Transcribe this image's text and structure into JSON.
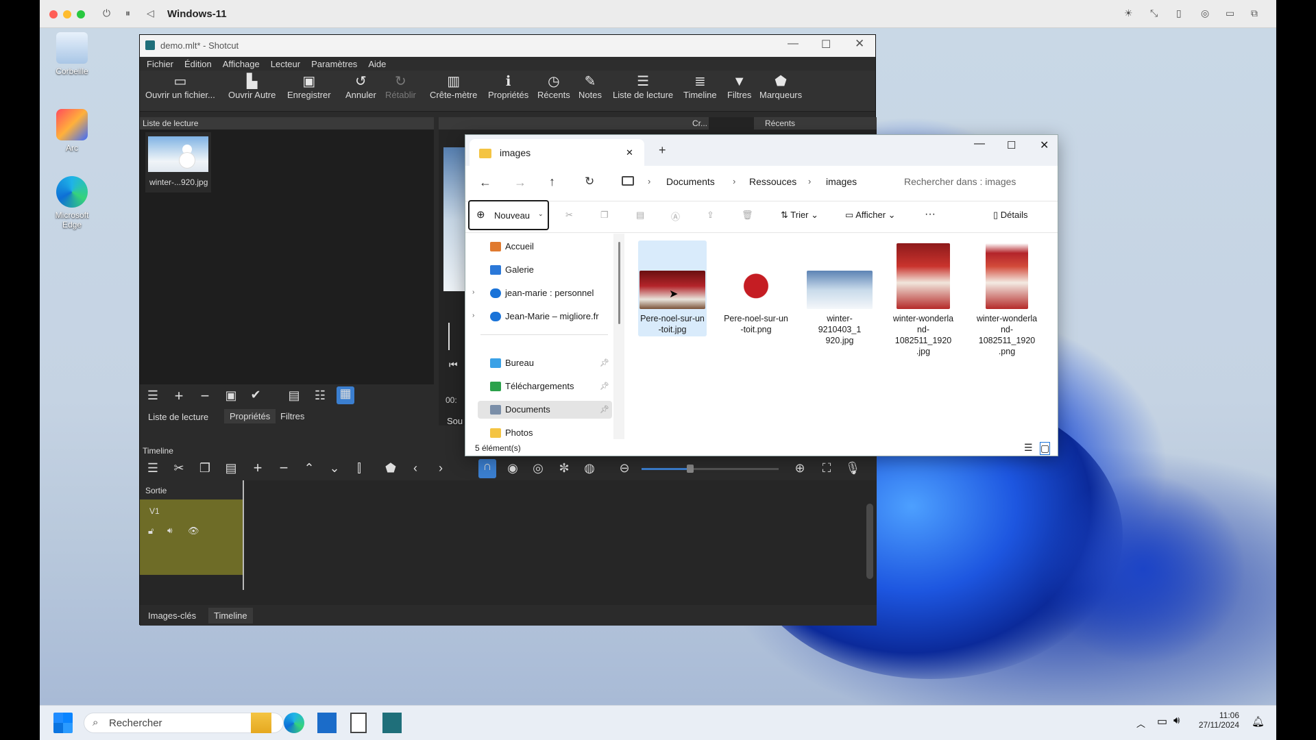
{
  "host": {
    "title": "Windows-11"
  },
  "desktop": {
    "icons": [
      {
        "label": "Corbeille"
      },
      {
        "label": "Arc"
      },
      {
        "label": "Microsoft Edge"
      }
    ]
  },
  "shotcut": {
    "title": "demo.mlt* - Shotcut",
    "menu": [
      "Fichier",
      "Édition",
      "Affichage",
      "Lecteur",
      "Paramètres",
      "Aide"
    ],
    "toolbar": [
      {
        "label": "Ouvrir un fichier...",
        "icon": "open-file-icon"
      },
      {
        "label": "Ouvrir Autre",
        "icon": "open-other-icon"
      },
      {
        "label": "Enregistrer",
        "icon": "save-icon"
      },
      {
        "label": "Annuler",
        "icon": "undo-icon"
      },
      {
        "label": "Rétablir",
        "icon": "redo-icon",
        "disabled": true
      },
      {
        "label": "Crête-mètre",
        "icon": "peak-meter-icon"
      },
      {
        "label": "Propriétés",
        "icon": "info-icon"
      },
      {
        "label": "Récents",
        "icon": "clock-icon"
      },
      {
        "label": "Notes",
        "icon": "notes-icon"
      },
      {
        "label": "Liste de lecture",
        "icon": "playlist-icon"
      },
      {
        "label": "Timeline",
        "icon": "timeline-icon"
      },
      {
        "label": "Filtres",
        "icon": "filter-icon"
      },
      {
        "label": "Marqueurs",
        "icon": "marker-icon"
      }
    ],
    "playlist": {
      "header": "Liste de lecture",
      "item": "winter-...920.jpg",
      "tabs": [
        "Liste de lecture",
        "Propriétés",
        "Filtres"
      ]
    },
    "side_headers": {
      "cr": "Cr...",
      "recents": "Récents"
    },
    "source_tab": "Sou",
    "timecode": "00:",
    "timeline": {
      "header": "Timeline",
      "output": "Sortie",
      "track": "V1",
      "tabs": [
        "Images-clés",
        "Timeline"
      ]
    }
  },
  "explorer": {
    "tab": "images",
    "breadcrumb": [
      "Documents",
      "Ressouces",
      "images"
    ],
    "search_placeholder": "Rechercher dans : images",
    "cmd": {
      "new": "Nouveau",
      "sort": "Trier",
      "view": "Afficher",
      "more": "···",
      "details": "Détails"
    },
    "sidebar": [
      {
        "label": "Accueil",
        "icon": "home-icon"
      },
      {
        "label": "Galerie",
        "icon": "gallery-icon"
      },
      {
        "label": "jean-marie : personnel",
        "icon": "cloud-icon",
        "expand": true
      },
      {
        "label": "Jean-Marie – migliore.fr",
        "icon": "cloud-icon",
        "expand": true
      },
      {
        "label": "Bureau",
        "icon": "desktop-icon",
        "pinned": true
      },
      {
        "label": "Téléchargements",
        "icon": "download-icon",
        "pinned": true
      },
      {
        "label": "Documents",
        "icon": "documents-icon",
        "pinned": true
      },
      {
        "label": "Photos",
        "icon": "folder-icon"
      }
    ],
    "files": [
      {
        "line1": "Pere-noel-sur-un",
        "line2": "-toit.jpg",
        "line3": "",
        "kind": "santa-roof"
      },
      {
        "line1": "Pere-noel-sur-un",
        "line2": "-toit.png",
        "line3": "",
        "kind": "santa-cutout"
      },
      {
        "line1": "winter-9210403_1",
        "line2": "920.jpg",
        "line3": "",
        "kind": "snowman"
      },
      {
        "line1": "winter-wonderla",
        "line2": "nd-1082511_1920",
        "line3": ".jpg",
        "kind": "girl"
      },
      {
        "line1": "winter-wonderla",
        "line2": "nd-1082511_1920",
        "line3": ".png",
        "kind": "girl"
      }
    ],
    "status": "5 élément(s)"
  },
  "taskbar": {
    "search": "Rechercher",
    "time": "11:06",
    "date": "27/11/2024"
  }
}
